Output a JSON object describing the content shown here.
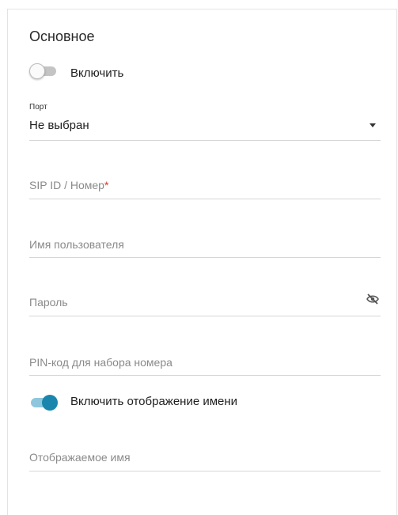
{
  "section": {
    "title": "Основное"
  },
  "enable_toggle": {
    "label": "Включить",
    "state": "off"
  },
  "port": {
    "label": "Порт",
    "value": "Не выбран"
  },
  "sip_id": {
    "placeholder": "SIP ID / Номер",
    "required_mark": "*"
  },
  "username": {
    "placeholder": "Имя пользователя"
  },
  "password": {
    "placeholder": "Пароль",
    "visibility_icon": "eye-off-icon"
  },
  "pin": {
    "placeholder": "PIN-код для набора номера"
  },
  "display_name_toggle": {
    "label": "Включить отображение имени",
    "state": "on"
  },
  "display_name": {
    "placeholder": "Отображаемое имя"
  },
  "colors": {
    "accent": "#1a86ad",
    "required": "#e0322a"
  }
}
